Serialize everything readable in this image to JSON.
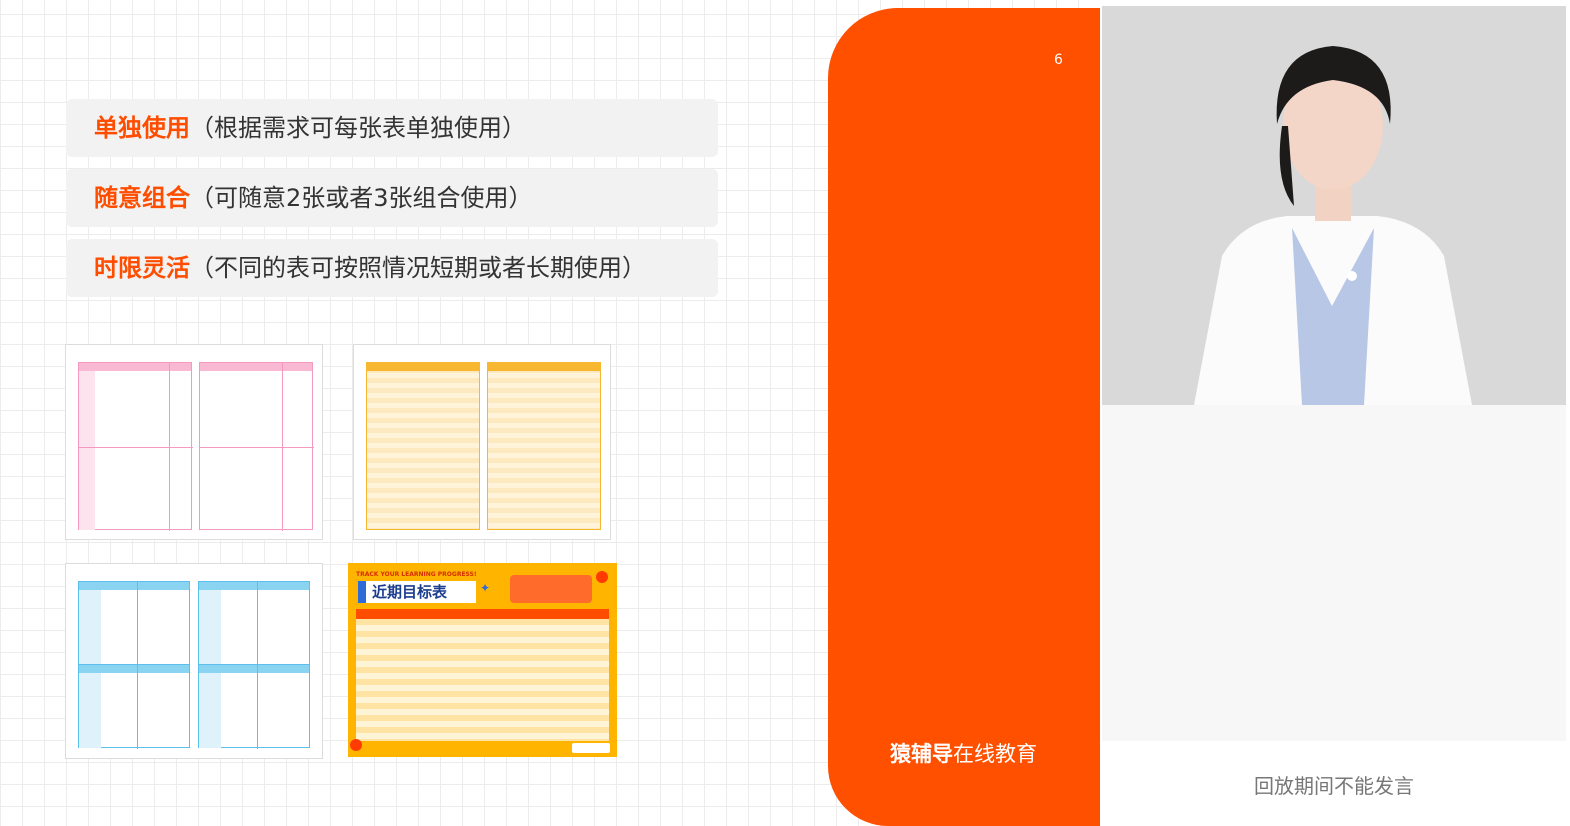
{
  "slide": {
    "page_number": "6",
    "rules": [
      {
        "key": "单独使用",
        "desc": "（根据需求可每张表单独使用）"
      },
      {
        "key": "随意组合",
        "desc": "（可随意2张或者3张组合使用）"
      },
      {
        "key": "时限灵活",
        "desc": "（不同的表可按照情况短期或者长期使用）"
      }
    ],
    "target_sheet": {
      "banner": "TRACK YOUR LEARNING PROGRESS!",
      "title": "近期目标表"
    }
  },
  "brand": {
    "bold": "猿辅导",
    "rest": "在线教育"
  },
  "sidebar": {
    "status_text": "回放期间不能发言"
  },
  "colors": {
    "accent": "#ff5000",
    "pink": "#f49ac1",
    "yellow": "#f7b731",
    "blue": "#5bc0eb"
  }
}
